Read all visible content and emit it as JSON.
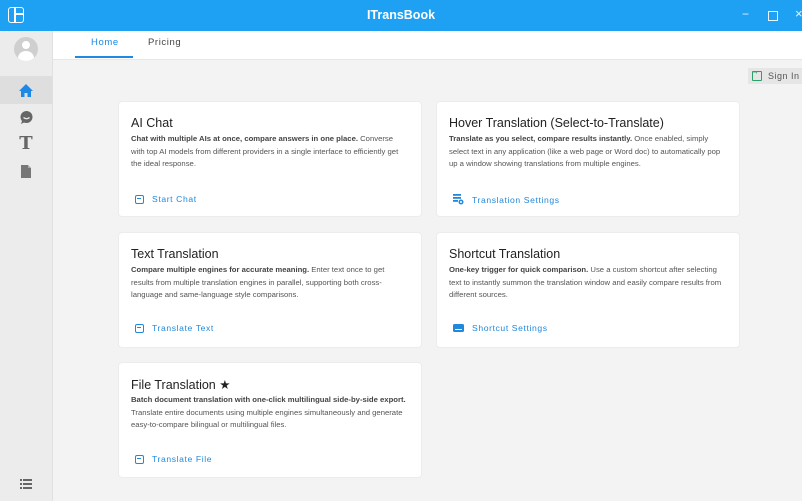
{
  "window": {
    "title": "ITransBook",
    "controls": {
      "minimize": "−",
      "close": "×"
    }
  },
  "tabs": [
    {
      "label": "Home",
      "active": true
    },
    {
      "label": "Pricing",
      "active": false
    }
  ],
  "auth": {
    "sign_in_label": "Sign In"
  },
  "sidebar": {
    "items": [
      {
        "name": "home",
        "icon": "home-icon",
        "active": true
      },
      {
        "name": "chat",
        "icon": "chat-icon",
        "active": false
      },
      {
        "name": "text-translation",
        "icon": "T",
        "active": false
      },
      {
        "name": "file-translation",
        "icon": "file-icon",
        "active": false
      }
    ],
    "bottom_icon": "list-icon"
  },
  "cards": [
    {
      "title": "AI Chat",
      "desc_bold": "Chat with multiple AIs at once, compare answers in one place.",
      "desc_rest": " Converse with top AI models from different providers in a single interface to efficiently get the ideal response.",
      "action_label": "Start Chat",
      "action_icon": "enter-icon"
    },
    {
      "title": "Hover Translation (Select-to-Translate)",
      "desc_bold": "Translate as you select, compare results instantly.",
      "desc_rest": " Once enabled, simply select text in any application (like a web page or Word doc) to automatically pop up a window showing translations from multiple engines.",
      "action_label": "Translation Settings",
      "action_icon": "settings-icon"
    },
    {
      "title": "Text Translation",
      "desc_bold": "Compare multiple engines for accurate meaning.",
      "desc_rest": " Enter text once to get results from multiple translation engines in parallel, supporting both cross-language and same-language style comparisons.",
      "action_label": "Translate Text",
      "action_icon": "enter-icon"
    },
    {
      "title": "Shortcut Translation",
      "desc_bold": "One-key trigger for quick comparison.",
      "desc_rest": " Use a custom shortcut after selecting text to instantly summon the translation window and easily compare results from different sources.",
      "action_label": "Shortcut Settings",
      "action_icon": "keyboard-icon"
    },
    {
      "title": "File Translation ★",
      "desc_bold": "Batch document translation with one-click multilingual side-by-side export.",
      "desc_rest": " Translate entire documents using multiple engines simultaneously and generate easy-to-compare bilingual or multilingual files.",
      "action_label": "Translate File",
      "action_icon": "enter-icon"
    }
  ],
  "colors": {
    "accent": "#1ea1f3",
    "link": "#2089dc",
    "sign_in_icon": "#2aa06a",
    "background": "#f3f3f3"
  }
}
